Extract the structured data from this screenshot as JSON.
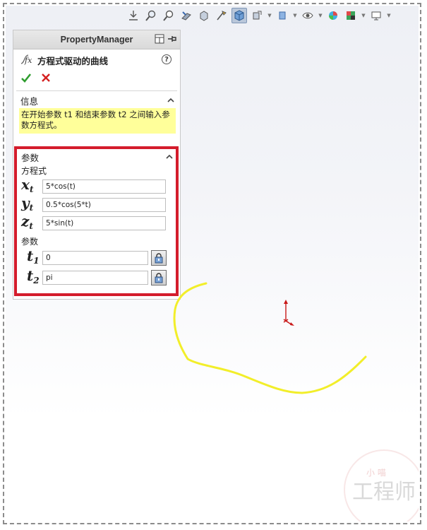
{
  "property_manager": {
    "title": "PropertyManager",
    "feature_name": "方程式驱动的曲线",
    "help": "?",
    "info_group": {
      "title": "信息",
      "message": "在开始参数 t1 和结束参数 t2 之间输入参数方程式。"
    },
    "params_group": {
      "title": "参数",
      "equation_label": "方程式",
      "equations": [
        {
          "var": "x",
          "sub": "t",
          "value": "5*cos(t)"
        },
        {
          "var": "y",
          "sub": "t",
          "value": "0.5*cos(5*t)"
        },
        {
          "var": "z",
          "sub": "t",
          "value": "5*sin(t)"
        }
      ],
      "params_label": "参数",
      "params": [
        {
          "var": "t",
          "sub": "1",
          "value": "0"
        },
        {
          "var": "t",
          "sub": "2",
          "value": "pi"
        }
      ]
    }
  },
  "colors": {
    "curve": "#f2ee2a",
    "highlight_border": "#d41c2c",
    "info_bg": "#ffff9a",
    "ok": "#2f9d2f",
    "cancel": "#d42020"
  },
  "watermark": {
    "main": "工程师",
    "small": "小 喵"
  }
}
